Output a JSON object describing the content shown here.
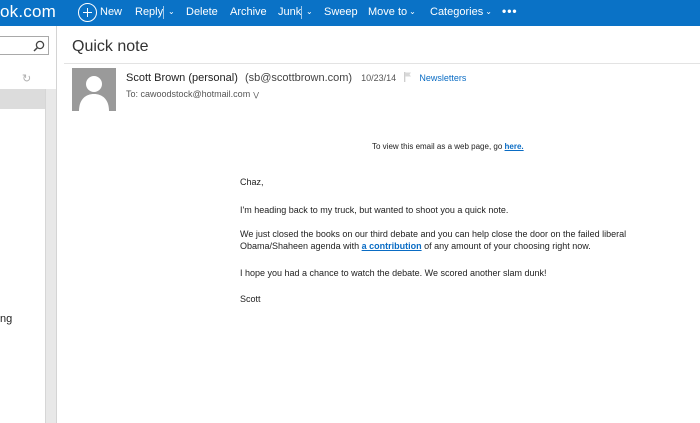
{
  "topbar": {
    "brand": "ok.com",
    "new_label": "New",
    "reply_label": "Reply",
    "delete_label": "Delete",
    "archive_label": "Archive",
    "junk_label": "Junk",
    "sweep_label": "Sweep",
    "move_to_label": "Move to",
    "categories_label": "Categories",
    "more_label": "•••"
  },
  "colors": {
    "topbar_bg": "#0a72c6",
    "link": "#0a6cc4"
  },
  "left_pane": {
    "partial_item": "ng"
  },
  "message": {
    "subject": "Quick note",
    "sender_name": "Scott Brown (personal)",
    "sender_email": "(sb@scottbrown.com)",
    "date": "10/23/14",
    "category": "Newsletters",
    "to_line": "To: cawoodstock@hotmail.com",
    "body": {
      "view_web_prefix": "To view this email as a web page, go",
      "view_web_link": "here.",
      "greeting": "Chaz,",
      "para1": "I'm heading back to my truck, but wanted to shoot you a quick note.",
      "para2_before": "We just closed the books on our third debate and you can help close the door on the failed liberal Obama/Shaheen agenda with",
      "para2_link": "a contribution",
      "para2_after": "of any amount of your choosing right now.",
      "para3": "I hope you had a chance to watch the debate. We scored another slam dunk!",
      "signoff": "Scott"
    }
  }
}
